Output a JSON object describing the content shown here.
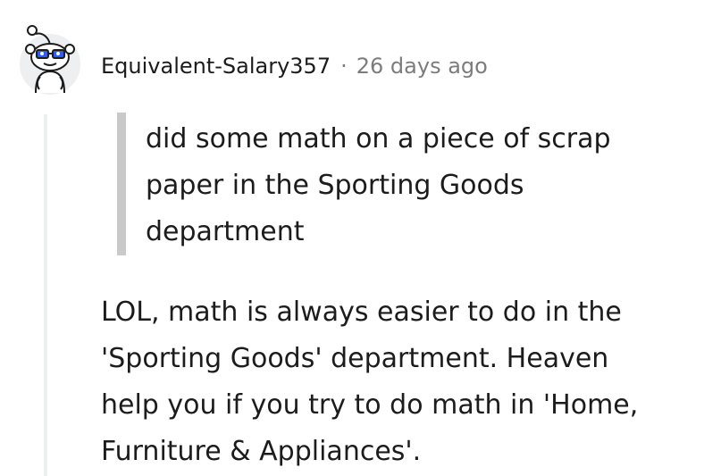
{
  "comment": {
    "author": "Equivalent-Salary357",
    "separator": "·",
    "timestamp": "26 days ago",
    "quote_lines": [
      "did some math on a piece of scrap",
      "paper in the Sporting Goods",
      "department"
    ],
    "body_lines": [
      "LOL, math is always easier to do in the",
      "'Sporting Goods' department. Heaven",
      "help you if you try to do math in 'Home,",
      "Furniture & Appliances'."
    ]
  },
  "avatar": {
    "icon": "reddit-snoo-avatar-icon",
    "glasses_color": "#2e5bff"
  },
  "colors": {
    "text": "#1c1c1c",
    "meta": "#7c7c7c",
    "quote_bar": "#c9c9c9",
    "thread_line": "#edeff1"
  }
}
